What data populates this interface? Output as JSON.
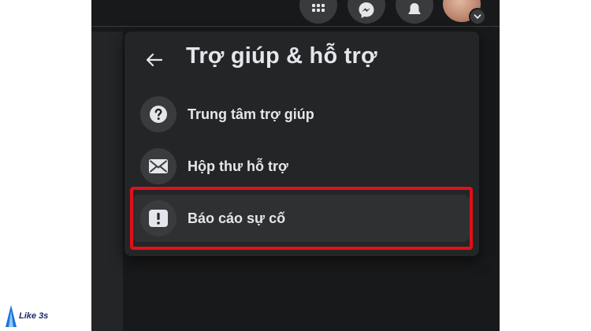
{
  "menu": {
    "title": "Trợ giúp & hỗ trợ",
    "items": [
      {
        "label": "Trung tâm trợ giúp",
        "icon": "question-icon"
      },
      {
        "label": "Hộp thư hỗ trợ",
        "icon": "envelope-icon"
      },
      {
        "label": "Báo cáo sự cố",
        "icon": "exclamation-icon"
      }
    ]
  },
  "topbar": {
    "icons": [
      "apps-grid-icon",
      "messenger-icon",
      "bell-icon"
    ]
  },
  "highlight": {
    "color": "#e0101a",
    "target": "Báo cáo sự cố"
  },
  "watermark": {
    "text": "Like 3s"
  }
}
